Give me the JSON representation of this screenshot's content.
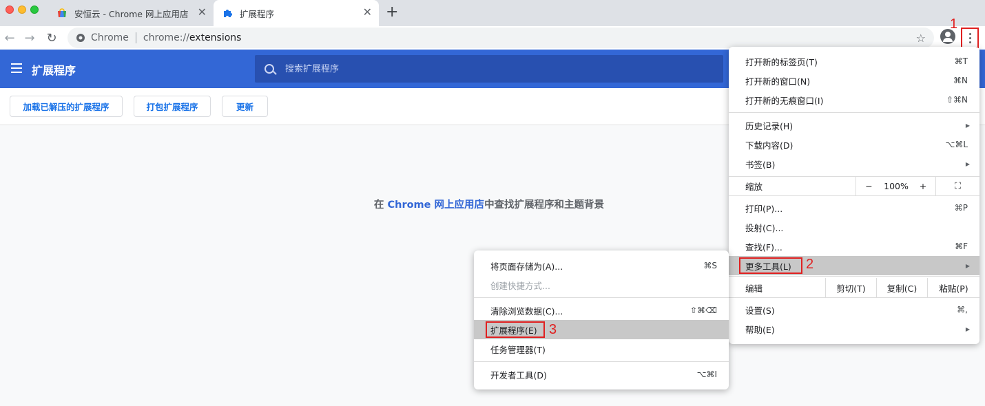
{
  "tabs": [
    {
      "title": "安恒云 - Chrome 网上应用店",
      "close": "✕"
    },
    {
      "title": "扩展程序",
      "close": "✕"
    }
  ],
  "newtab_label": "+",
  "toolbar": {
    "back": "←",
    "forward": "→",
    "reload": "↻",
    "site_label": "Chrome",
    "url_scheme": "chrome://",
    "url_host": "extensions",
    "bookmark_star": "☆"
  },
  "annotations": {
    "n1": "1",
    "n2": "2",
    "n3": "3"
  },
  "ext": {
    "title": "扩展程序",
    "search_placeholder": "搜索扩展程序",
    "buttons": {
      "load": "加载已解压的扩展程序",
      "pack": "打包扩展程序",
      "update": "更新"
    },
    "empty_prefix": "在 ",
    "empty_link": "Chrome 网上应用店",
    "empty_suffix": "中查找扩展程序和主题背景"
  },
  "main_menu": {
    "new_tab": {
      "label": "打开新的标签页(T)",
      "shortcut": "⌘T"
    },
    "new_window": {
      "label": "打开新的窗口(N)",
      "shortcut": "⌘N"
    },
    "incognito": {
      "label": "打开新的无痕窗口(I)",
      "shortcut": "⇧⌘N"
    },
    "history": {
      "label": "历史记录(H)",
      "arrow": "▶"
    },
    "downloads": {
      "label": "下载内容(D)",
      "shortcut": "⌥⌘L"
    },
    "bookmarks": {
      "label": "书签(B)",
      "arrow": "▶"
    },
    "zoom": {
      "label": "缩放",
      "minus": "−",
      "value": "100%",
      "plus": "+",
      "fullscreen": "⛶"
    },
    "print": {
      "label": "打印(P)...",
      "shortcut": "⌘P"
    },
    "cast": {
      "label": "投射(C)..."
    },
    "find": {
      "label": "查找(F)...",
      "shortcut": "⌘F"
    },
    "more_tools": {
      "label": "更多工具(L)",
      "arrow": "▶"
    },
    "edit": {
      "label": "编辑",
      "cut": "剪切(T)",
      "copy": "复制(C)",
      "paste": "粘贴(P)"
    },
    "settings": {
      "label": "设置(S)",
      "shortcut": "⌘,"
    },
    "help": {
      "label": "帮助(E)",
      "arrow": "▶"
    }
  },
  "sub_menu": {
    "save_page": {
      "label": "将页面存储为(A)...",
      "shortcut": "⌘S"
    },
    "create_shortcut": {
      "label": "创建快捷方式..."
    },
    "clear_data": {
      "label": "清除浏览数据(C)...",
      "shortcut": "⇧⌘⌫"
    },
    "extensions": {
      "label": "扩展程序(E)"
    },
    "task_manager": {
      "label": "任务管理器(T)"
    },
    "dev_tools": {
      "label": "开发者工具(D)",
      "shortcut": "⌥⌘I"
    }
  }
}
